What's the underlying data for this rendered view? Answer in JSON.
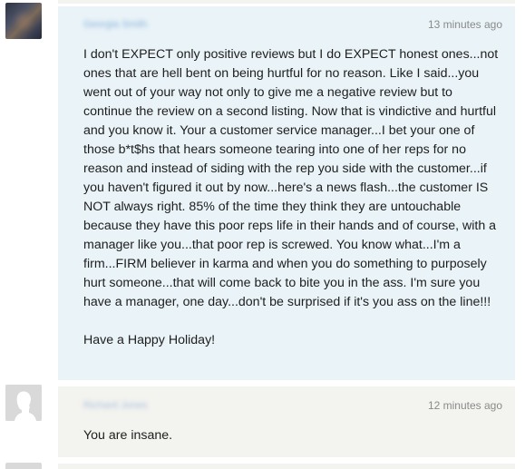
{
  "comments": [
    {
      "author": "Georgia Smith",
      "timestamp": "13 minutes ago",
      "text": "I don't EXPECT only positive reviews but I do EXPECT honest ones...not ones that are hell bent on being hurtful for no reason. Like I said...you went out of your way not only to give me a negative review but to continue the review on a second listing. Now that is vindictive and hurtful and you know it. Your a customer service manager...I bet your one of those b*t$hs that hears someone tearing into one of her reps for no reason and instead of siding with the rep you side with the customer...if you haven't figured it out by now...here's a news flash...the customer IS NOT always right. 85% of the time they think they are untouchable because they have this poor reps life in their hands and of course, with a manager like you...that poor rep is screwed. You know what...I'm a firm...FIRM believer in karma and when you do something to purposely hurt someone...that will come back to bite you in the ass. I'm sure you have a manager, one day...don't be surprised if it's you ass on the line!!!\n\nHave a Happy Holiday!"
    },
    {
      "author": "Richard Jones",
      "timestamp": "12 minutes ago",
      "text": "You are insane."
    }
  ]
}
